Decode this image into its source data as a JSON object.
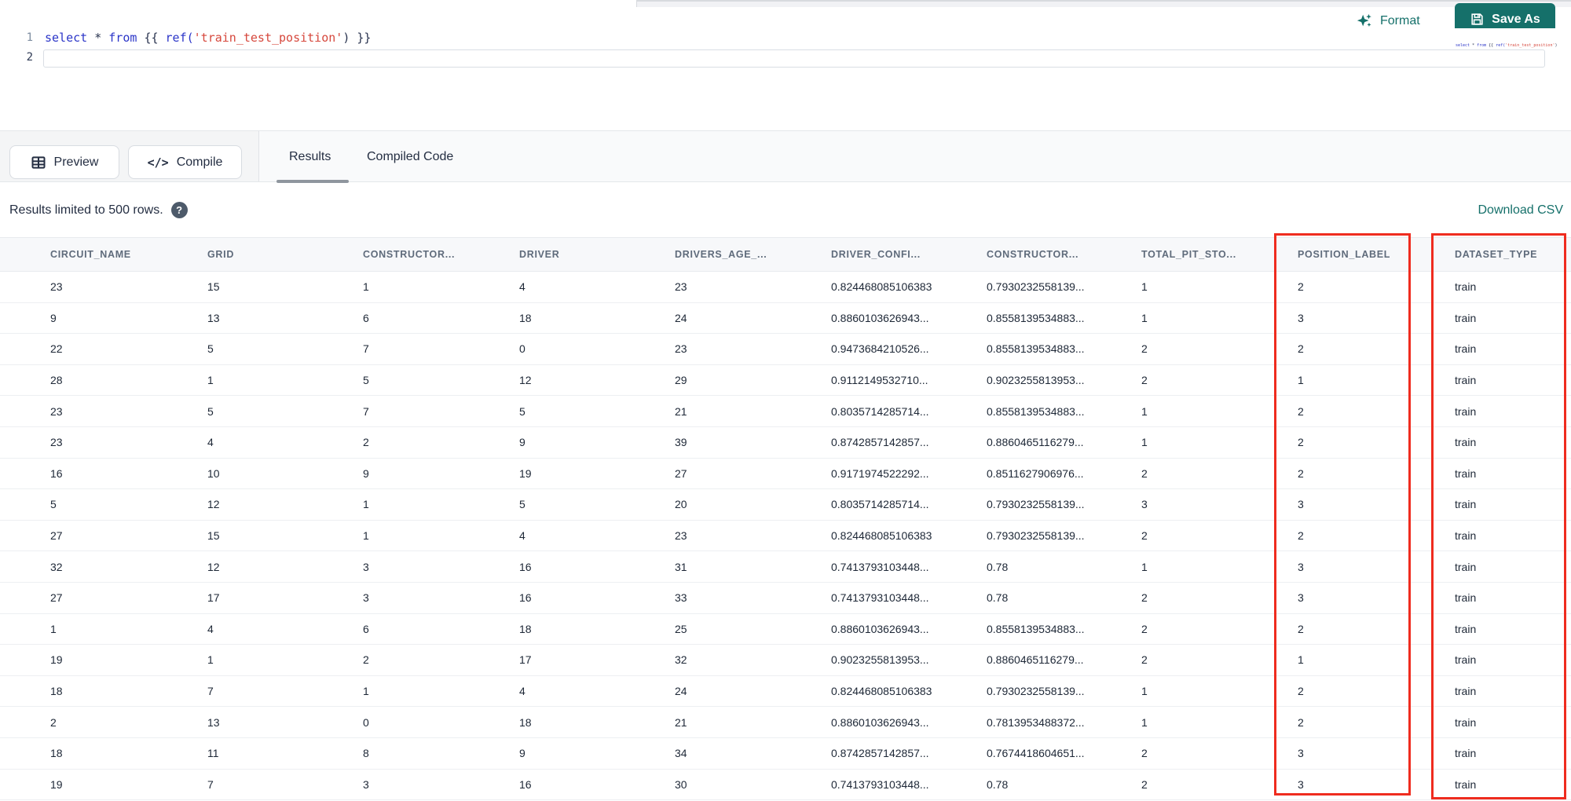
{
  "editor": {
    "line_numbers": [
      "1",
      "2"
    ],
    "tokens": [
      {
        "text": "select ",
        "type": "keyword"
      },
      {
        "text": "* ",
        "type": "operator"
      },
      {
        "text": "from ",
        "type": "keyword"
      },
      {
        "text": "{{ ",
        "type": "brace"
      },
      {
        "text": "ref(",
        "type": "function"
      },
      {
        "text": "'train_test_position'",
        "type": "string"
      },
      {
        "text": ") ",
        "type": "plain"
      },
      {
        "text": "}}",
        "type": "brace"
      }
    ]
  },
  "actions": {
    "format": "Format",
    "save_as": "Save As"
  },
  "toolbar": {
    "preview": "Preview",
    "compile": "Compile",
    "compile_icon_glyph": "</>"
  },
  "tabs": {
    "results": "Results",
    "compiled_code": "Compiled Code",
    "active_tab": "Results"
  },
  "results_bar": {
    "info": "Results limited to 500 rows.",
    "help_glyph": "?",
    "download": "Download CSV"
  },
  "table": {
    "columns": [
      "CIRCUIT_NAME",
      "GRID",
      "CONSTRUCTOR...",
      "DRIVER",
      "DRIVERS_AGE_...",
      "DRIVER_CONFI...",
      "CONSTRUCTOR...",
      "TOTAL_PIT_STO...",
      "POSITION_LABEL",
      "DATASET_TYPE"
    ],
    "rows": [
      [
        "23",
        "15",
        "1",
        "4",
        "23",
        "0.824468085106383",
        "0.7930232558139...",
        "1",
        "2",
        "train"
      ],
      [
        "9",
        "13",
        "6",
        "18",
        "24",
        "0.8860103626943...",
        "0.8558139534883...",
        "1",
        "3",
        "train"
      ],
      [
        "22",
        "5",
        "7",
        "0",
        "23",
        "0.9473684210526...",
        "0.8558139534883...",
        "2",
        "2",
        "train"
      ],
      [
        "28",
        "1",
        "5",
        "12",
        "29",
        "0.9112149532710...",
        "0.9023255813953...",
        "2",
        "1",
        "train"
      ],
      [
        "23",
        "5",
        "7",
        "5",
        "21",
        "0.8035714285714...",
        "0.8558139534883...",
        "1",
        "2",
        "train"
      ],
      [
        "23",
        "4",
        "2",
        "9",
        "39",
        "0.8742857142857...",
        "0.8860465116279...",
        "1",
        "2",
        "train"
      ],
      [
        "16",
        "10",
        "9",
        "19",
        "27",
        "0.9171974522292...",
        "0.8511627906976...",
        "2",
        "2",
        "train"
      ],
      [
        "5",
        "12",
        "1",
        "5",
        "20",
        "0.8035714285714...",
        "0.7930232558139...",
        "3",
        "3",
        "train"
      ],
      [
        "27",
        "15",
        "1",
        "4",
        "23",
        "0.824468085106383",
        "0.7930232558139...",
        "2",
        "2",
        "train"
      ],
      [
        "32",
        "12",
        "3",
        "16",
        "31",
        "0.7413793103448...",
        "0.78",
        "1",
        "3",
        "train"
      ],
      [
        "27",
        "17",
        "3",
        "16",
        "33",
        "0.7413793103448...",
        "0.78",
        "2",
        "3",
        "train"
      ],
      [
        "1",
        "4",
        "6",
        "18",
        "25",
        "0.8860103626943...",
        "0.8558139534883...",
        "2",
        "2",
        "train"
      ],
      [
        "19",
        "1",
        "2",
        "17",
        "32",
        "0.9023255813953...",
        "0.8860465116279...",
        "2",
        "1",
        "train"
      ],
      [
        "18",
        "7",
        "1",
        "4",
        "24",
        "0.824468085106383",
        "0.7930232558139...",
        "1",
        "2",
        "train"
      ],
      [
        "2",
        "13",
        "0",
        "18",
        "21",
        "0.8860103626943...",
        "0.7813953488372...",
        "1",
        "2",
        "train"
      ],
      [
        "18",
        "11",
        "8",
        "9",
        "34",
        "0.8742857142857...",
        "0.7674418604651...",
        "2",
        "3",
        "train"
      ],
      [
        "19",
        "7",
        "3",
        "16",
        "30",
        "0.7413793103448...",
        "0.78",
        "2",
        "3",
        "train"
      ]
    ],
    "highlighted_columns": [
      "POSITION_LABEL",
      "DATASET_TYPE"
    ]
  },
  "colors": {
    "accent_teal": "#15706a",
    "highlight_red": "#ef2c1f",
    "keyword_blue": "#2b35c8",
    "string_red": "#d6473c"
  }
}
